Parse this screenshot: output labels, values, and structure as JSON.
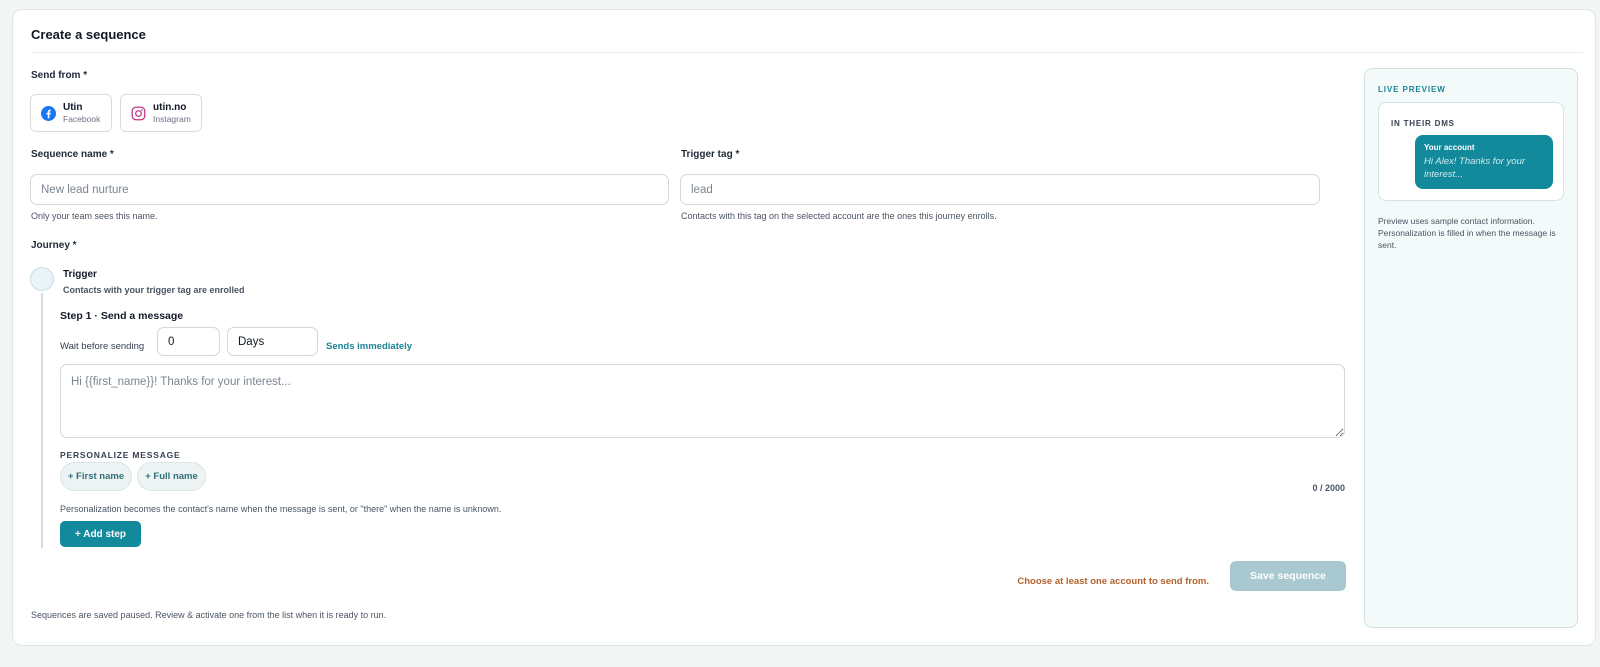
{
  "page": {
    "title": "Create a sequence",
    "footer_note": "Sequences are saved paused. Review & activate one from the list when it is ready to run."
  },
  "send_from": {
    "label": "Send from *",
    "accounts": [
      {
        "name": "Utin",
        "platform": "Facebook",
        "icon": "facebook-icon",
        "color": "#1877f2"
      },
      {
        "name": "utin.no",
        "platform": "Instagram",
        "icon": "instagram-icon",
        "color": "#c13584"
      }
    ]
  },
  "sequence_name": {
    "label": "Sequence name *",
    "placeholder": "New lead nurture",
    "value": "",
    "hint": "Only your team sees this name."
  },
  "trigger_tag": {
    "label": "Trigger tag *",
    "placeholder": "lead",
    "value": "",
    "hint": "Contacts with this tag on the selected account are the ones this journey enrolls."
  },
  "journey": {
    "label": "Journey *",
    "trigger_title": "Trigger",
    "trigger_subtitle": "Contacts with your trigger tag are enrolled",
    "step": {
      "title": "Step 1 · Send a message",
      "wait_label": "Wait before sending",
      "wait_value": "0",
      "wait_unit": "Days",
      "wait_status": "Sends immediately",
      "message_placeholder": "Hi {{first_name}}! Thanks for your interest...",
      "message_value": "",
      "personalize_label": "PERSONALIZE MESSAGE",
      "chips": [
        "+ First name",
        "+ Full name"
      ],
      "char_count": "0 / 2000",
      "personalize_hint": "Personalization becomes the contact's name when the message is sent, or \"there\" when the name is unknown."
    },
    "add_step_label": "+ Add step"
  },
  "actions": {
    "warning": "Choose at least one account to send from.",
    "save_label": "Save sequence"
  },
  "preview": {
    "title": "LIVE PREVIEW",
    "dm_label": "IN THEIR DMS",
    "bubble_account": "Your account",
    "bubble_text": "Hi Alex! Thanks for your interest...",
    "note": "Preview uses sample contact information. Personalization is filled in when the message is sent."
  },
  "colors": {
    "accent": "#138a9c",
    "warning": "#b4622e",
    "save_disabled": "#a9c9d1"
  }
}
